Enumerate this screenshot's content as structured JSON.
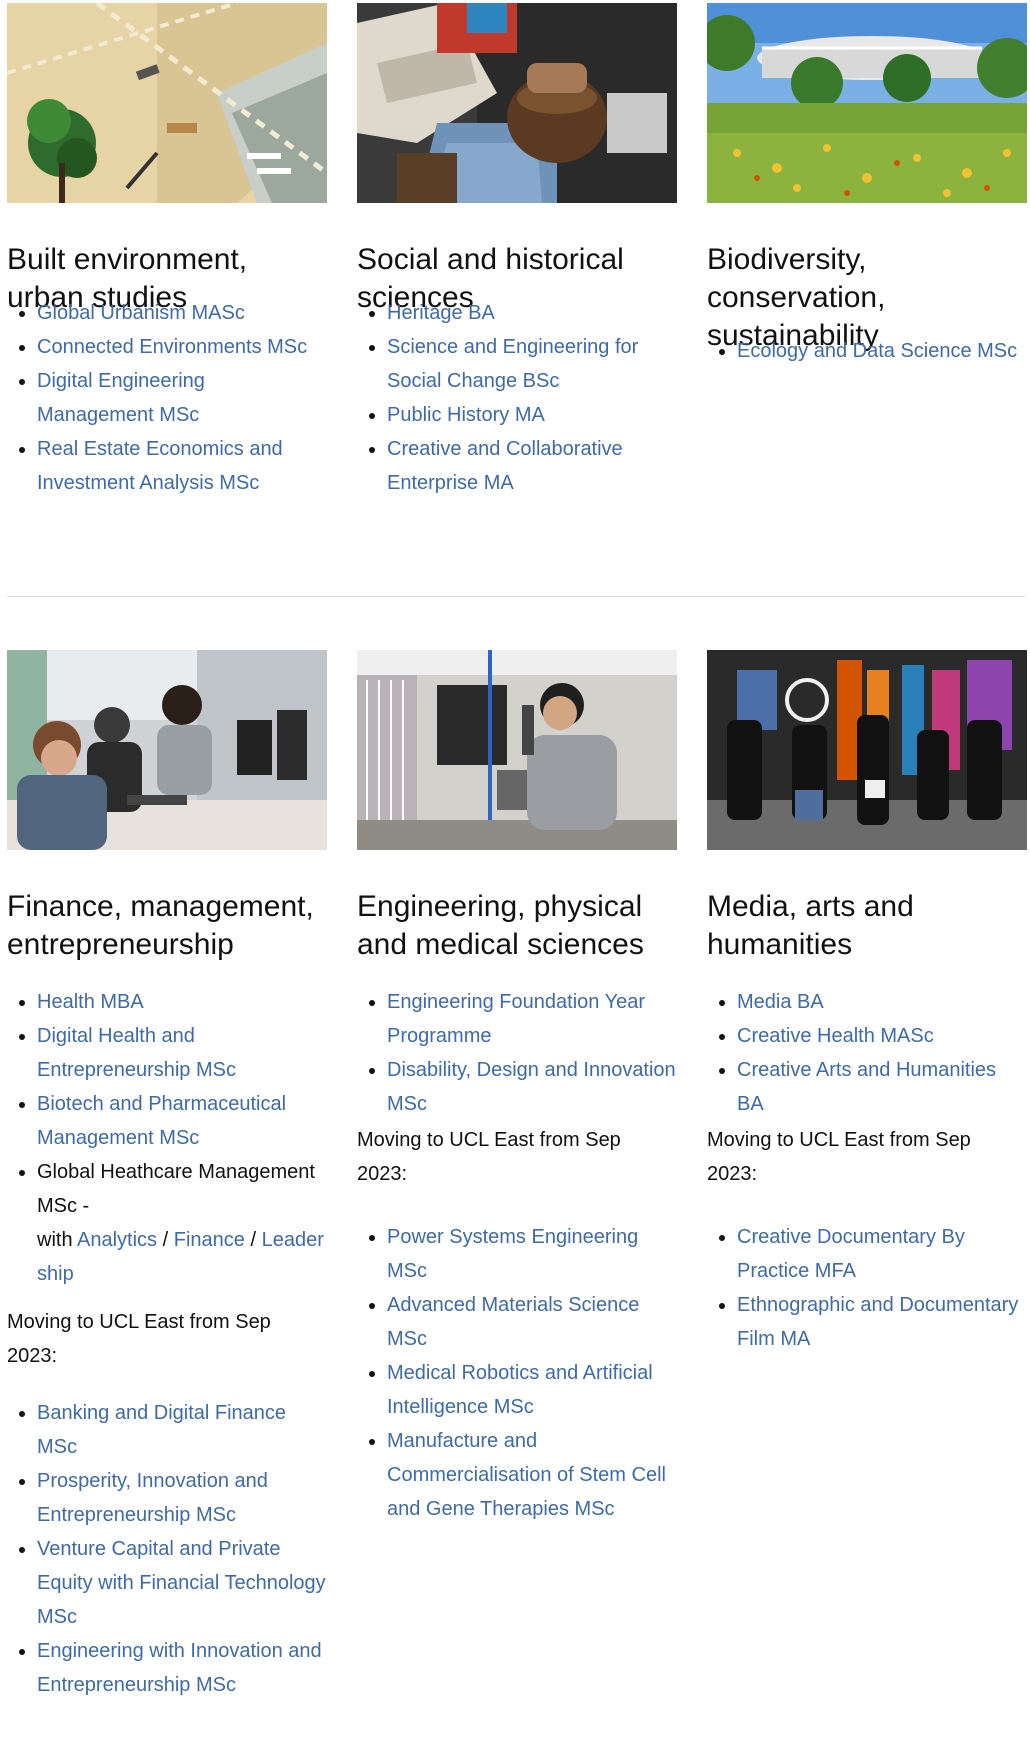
{
  "row1": [
    {
      "title": "Built environment, urban studies",
      "items": [
        "Global Urbanism MASc",
        "Connected Environments MSc",
        "Digital Engineering Management MSc",
        "Real Estate Economics and Investment Analysis MSc"
      ]
    },
    {
      "title": "Social and historical sciences",
      "items": [
        "Heritage BA",
        "Science and Engineering for Social Change BSc",
        "Public History MA",
        "Creative and Collaborative Enterprise MA"
      ]
    },
    {
      "title": "Biodiversity, conservation, sustainability",
      "items": [
        "Ecology and Data Science MSc"
      ]
    }
  ],
  "row2": [
    {
      "title": "Finance, management, entrepreneurship",
      "items": [
        "Health MBA",
        "Digital Health and Entrepreneurship MSc",
        "Biotech and Pharmaceutical Management MSc"
      ],
      "special": {
        "prefix": "Global Heathcare Management MSc -",
        "with": "with",
        "links": [
          "Analytics",
          "Finance",
          "Leader ship"
        ],
        "separator": "/"
      },
      "moving_note": "Moving to UCL East from Sep 2023:",
      "moving_items": [
        "Banking and Digital Finance MSc",
        "Prosperity, Innovation and Entrepreneurship MSc",
        "Venture Capital and Private Equity with Financial Technology MSc",
        "Engineering with Innovation and Entrepreneurship MSc"
      ]
    },
    {
      "title": "Engineering, physical and medical sciences",
      "items": [
        "Engineering Foundation Year Programme",
        "Disability, Design and Innovation MSc"
      ],
      "moving_note": "Moving to UCL East from Sep 2023:",
      "moving_items": [
        "Power Systems Engineering MSc",
        "Advanced Materials Science MSc",
        "Medical Robotics and Artificial Intelligence MSc",
        "Manufacture and Commercialisation of Stem Cell and Gene Therapies MSc"
      ]
    },
    {
      "title": "Media, arts and humanities",
      "items": [
        "Media BA",
        "Creative Health MASc",
        "Creative Arts and Humanities BA"
      ],
      "moving_note": "Moving to UCL East from Sep 2023:",
      "moving_items": [
        "Creative Documentary By Practice MFA",
        "Ethnographic and Documentary Film MA"
      ]
    }
  ],
  "colors": {
    "link": "#3f6aa6",
    "text": "#111111",
    "divider": "#d9d9d9"
  }
}
